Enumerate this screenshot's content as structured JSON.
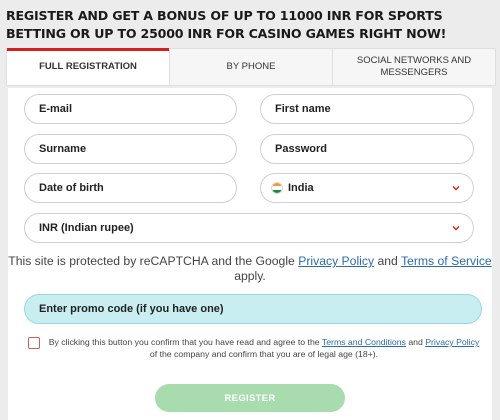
{
  "headline": "REGISTER AND GET A BONUS OF UP TO 11000 INR FOR SPORTS BETTING OR UP TO 25000 INR FOR CASINO GAMES RIGHT NOW!",
  "tabs": [
    {
      "label": "FULL REGISTRATION",
      "active": true
    },
    {
      "label": "BY PHONE",
      "active": false
    },
    {
      "label": "SOCIAL NETWORKS AND MESSENGERS",
      "active": false
    }
  ],
  "fields": {
    "email": "E-mail",
    "first_name": "First name",
    "surname": "Surname",
    "password": "Password",
    "dob": "Date of birth",
    "country": "India",
    "currency": "INR (Indian rupee)"
  },
  "captcha": {
    "pre": "This site is protected by reCAPTCHA and the Google ",
    "privacy": "Privacy Policy",
    "mid": " and ",
    "terms": "Terms of Service",
    "post": " apply."
  },
  "promo_placeholder": "Enter promo code (if you have one)",
  "consent": {
    "pre": "By clicking this button you confirm that you have read and agree to the ",
    "terms": "Terms and Conditions",
    "mid": " and ",
    "privacy": "Privacy Policy",
    "post": " of the company and confirm that you are of legal age (18+)."
  },
  "register_label": "REGISTER",
  "colors": {
    "accent": "#d6201f",
    "register": "#a8dcae",
    "promo": "#c8eef2",
    "link": "#2b6cb0"
  },
  "icons": {
    "dropdown": "chevron-down-icon",
    "flag": "india-flag-icon"
  }
}
